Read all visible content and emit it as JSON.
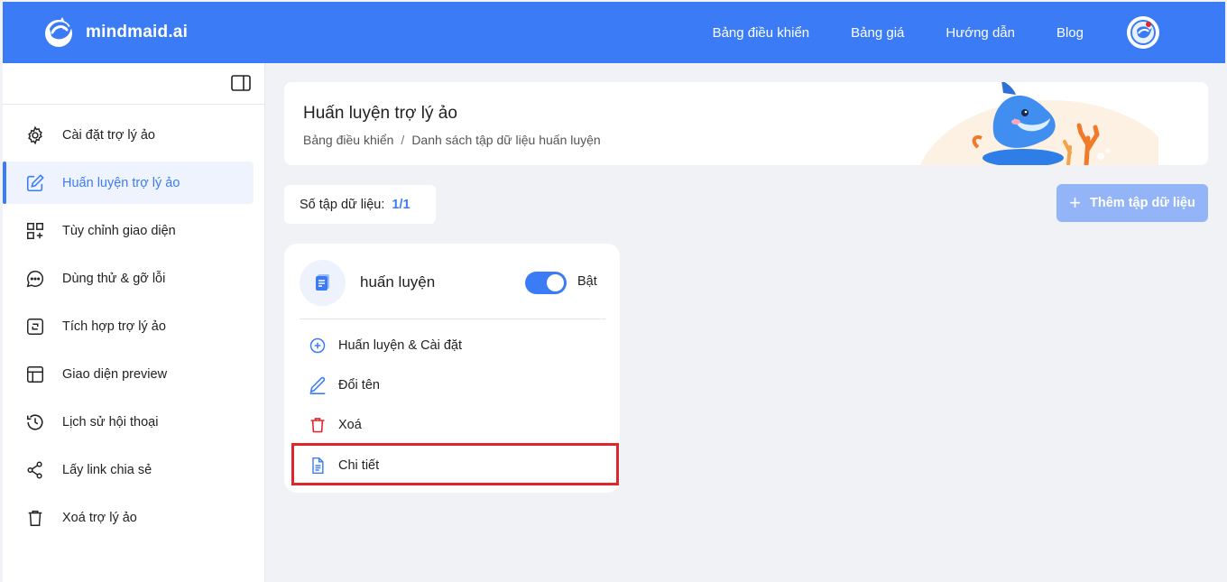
{
  "header": {
    "brand": "mindmaid.ai",
    "nav": [
      "Bảng điều khiển",
      "Bảng giá",
      "Hướng dẫn",
      "Blog"
    ]
  },
  "sidebar": {
    "items": [
      {
        "label": "Cài đặt trợ lý ảo",
        "icon": "gear-icon"
      },
      {
        "label": "Huấn luyện trợ lý ảo",
        "icon": "edit-icon",
        "active": true
      },
      {
        "label": "Tùy chỉnh giao diện",
        "icon": "grid-plus-icon"
      },
      {
        "label": "Dùng thử & gỡ lỗi",
        "icon": "chat-icon"
      },
      {
        "label": "Tích hợp trợ lý ảo",
        "icon": "integration-icon"
      },
      {
        "label": "Giao diện preview",
        "icon": "layout-icon"
      },
      {
        "label": "Lịch sử hội thoại",
        "icon": "history-icon"
      },
      {
        "label": "Lấy link chia sẻ",
        "icon": "share-icon"
      },
      {
        "label": "Xoá trợ lý ảo",
        "icon": "trash-icon"
      }
    ]
  },
  "banner": {
    "title": "Huấn luyện trợ lý ảo",
    "breadcrumb": [
      "Bảng điều khiển",
      "/",
      "Danh sách tập dữ liệu huấn luyện"
    ]
  },
  "dataset_count": {
    "label": "Số tập dữ liệu:",
    "value": "1/1"
  },
  "add_button": {
    "label": "Thêm tập dữ liệu",
    "icon": "plus-icon"
  },
  "dataset_card": {
    "name": "huấn luyện",
    "toggle_on": true,
    "toggle_label": "Bật",
    "actions": [
      {
        "label": "Huấn luyện & Cài đặt",
        "icon": "plus-circle-icon",
        "color": "#3b7cf6"
      },
      {
        "label": "Đổi tên",
        "icon": "pen-icon",
        "color": "#3b7cf6"
      },
      {
        "label": "Xoá",
        "icon": "trash-icon",
        "color": "#e0262b"
      },
      {
        "label": "Chi tiết",
        "icon": "document-icon",
        "color": "#3b7cf6"
      }
    ]
  },
  "colors": {
    "primary": "#3b7cf6",
    "danger": "#e0262b",
    "highlight": "#e0262b"
  }
}
